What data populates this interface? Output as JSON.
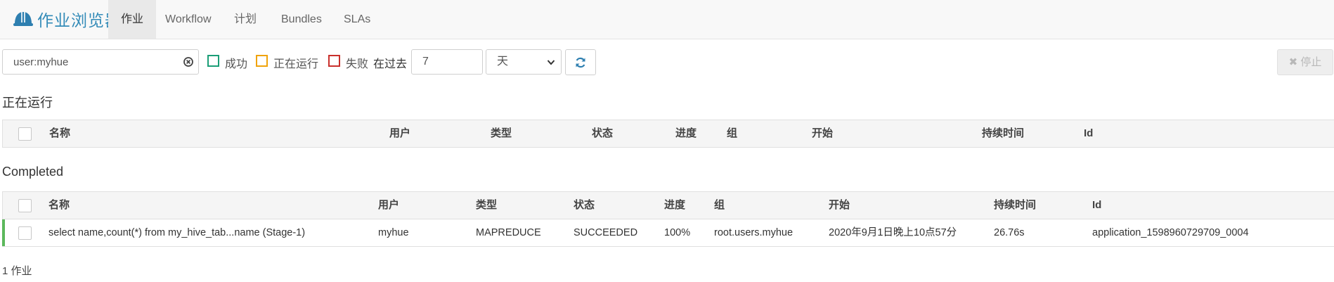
{
  "app": {
    "title": "作业浏览器",
    "tabs": [
      {
        "label": "作业",
        "active": true
      },
      {
        "label": "Workflow"
      },
      {
        "label": "计划"
      },
      {
        "label": "Bundles"
      },
      {
        "label": "SLAs"
      }
    ]
  },
  "filters": {
    "search_value": "user:myhue",
    "status_options": [
      {
        "label": "成功",
        "color": "#1b9e77"
      },
      {
        "label": "正在运行",
        "color": "#f0a30a"
      },
      {
        "label": "失败",
        "color": "#c9302c"
      }
    ],
    "past_label": "在过去",
    "days_value": "7",
    "unit_value": "天",
    "stop_label": "停止"
  },
  "running": {
    "title": "正在运行",
    "columns": [
      "名称",
      "用户",
      "类型",
      "状态",
      "进度",
      "组",
      "开始",
      "持续时间",
      "Id"
    ]
  },
  "completed": {
    "title": "Completed",
    "columns": [
      "名称",
      "用户",
      "类型",
      "状态",
      "进度",
      "组",
      "开始",
      "持续时间",
      "Id"
    ],
    "rows": [
      {
        "name": "select name,count(*) from my_hive_tab...name (Stage-1)",
        "user": "myhue",
        "type": "MAPREDUCE",
        "status": "SUCCEEDED",
        "progress": "100%",
        "group": "root.users.myhue",
        "start": "2020年9月1日晚上10点57分",
        "duration": "26.76s",
        "id": "application_1598960729709_0004"
      }
    ]
  },
  "footer": {
    "count_text": "1 作业"
  },
  "colors": {
    "brand": "#338bb8",
    "success_accent": "#5cb85c"
  }
}
